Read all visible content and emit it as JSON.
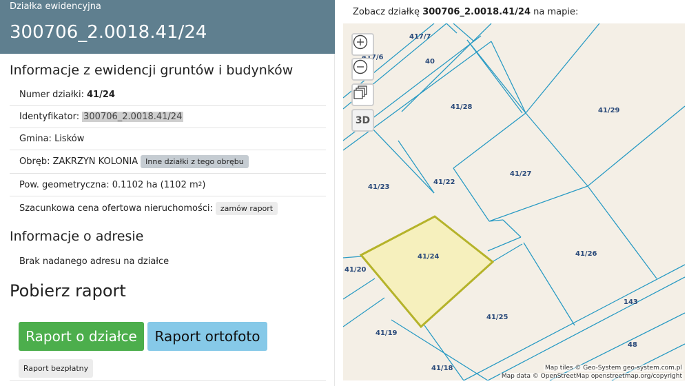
{
  "header": {
    "label": "Działka ewidencyjna",
    "title": "300706_2.0018.41/24"
  },
  "info": {
    "section_title": "Informacje z ewidencji gruntów i budynków",
    "numer_label": "Numer działki:",
    "numer_value": "41/24",
    "ident_label": "Identyfikator:",
    "ident_value": "300706_2.0018.41/24",
    "gmina": "Gmina: Lisków",
    "obreb_label": "Obręb: ZAKRZYN KOLONIA",
    "obreb_button": "Inne działki z tego obrębu",
    "pow_label": "Pow. geometryczna: 0.1102 ha (1102 m",
    "pow_sup": "2",
    "pow_close": ")",
    "cena_label": "Szacunkowa cena ofertowa nieruchomości:",
    "cena_button": "zamów raport"
  },
  "address": {
    "section_title": "Informacje o adresie",
    "text": "Brak nadanego adresu na działce"
  },
  "report": {
    "title": "Pobierz raport",
    "btn_dzialka": "Raport o działce",
    "btn_ortofoto": "Raport ortofoto",
    "btn_free": "Raport bezpłatny"
  },
  "map": {
    "caption_prefix": "Zobacz działkę ",
    "caption_id": "300706_2.0018.41/24",
    "caption_suffix": " na mapie:",
    "zoom_in_icon": "plus-circle-icon",
    "zoom_out_icon": "minus-circle-icon",
    "layers_icon": "layers-icon",
    "btn_3d": "3D",
    "attrib_tiles": "Map tiles © Geo-System geo-system.com.pl",
    "attrib_data": "Map data © OpenStreetMap openstreetmap.org/copyright",
    "labels": {
      "l4177": "417/7",
      "l4176": "417/6",
      "l40": "40",
      "l4128": "41/28",
      "l4129": "41/29",
      "l4127": "41/27",
      "l4122": "41/22",
      "l4123": "41/23",
      "l4124": "41/24",
      "l4126": "41/26",
      "l4120": "41/20",
      "l143": "143",
      "l4125": "41/25",
      "l4119": "41/19",
      "l48": "48",
      "l4118": "41/18"
    },
    "colors": {
      "background": "#f4efe6",
      "parcel_line": "#2a9bc4",
      "highlight_fill": "#f6f0bd",
      "highlight_stroke": "#b5b32a",
      "label": "#2a4a7a"
    }
  }
}
